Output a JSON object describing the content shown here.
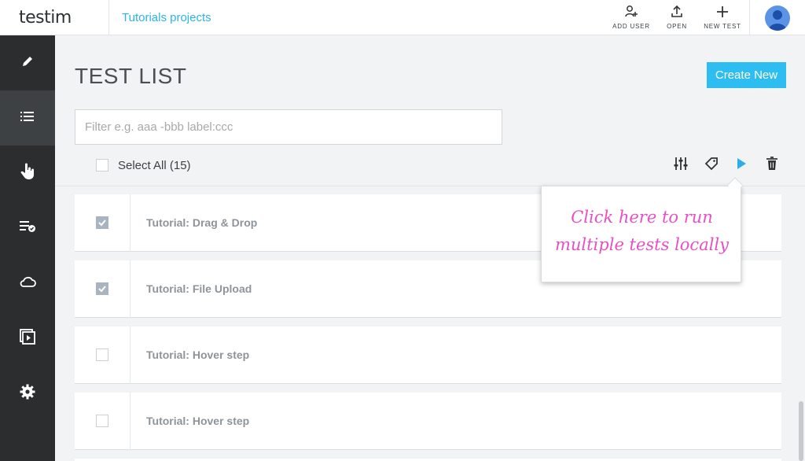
{
  "header": {
    "logo": "testim",
    "project": "Tutorials projects",
    "buttons": {
      "add_user": "ADD USER",
      "open": "OPEN",
      "new_test": "NEW TEST"
    }
  },
  "sidebar": {
    "items": [
      {
        "icon": "pencil-icon",
        "active": false
      },
      {
        "icon": "list-icon",
        "active": true
      },
      {
        "icon": "hand-pointer-icon",
        "active": false
      },
      {
        "icon": "checklist-icon",
        "active": false
      },
      {
        "icon": "cloud-icon",
        "active": false
      },
      {
        "icon": "video-icon",
        "active": false
      },
      {
        "icon": "gear-icon",
        "active": false
      }
    ]
  },
  "main": {
    "title": "TEST LIST",
    "create_button": "Create New",
    "filter_placeholder": "Filter e.g. aaa -bbb label:ccc",
    "select_all": "Select All (15)",
    "tests": [
      {
        "name": "Tutorial: Drag & Drop",
        "checked": true
      },
      {
        "name": "Tutorial: File Upload",
        "checked": true
      },
      {
        "name": "Tutorial: Hover step",
        "checked": false
      },
      {
        "name": "Tutorial: Hover step",
        "checked": false
      }
    ]
  },
  "tooltip": {
    "line1": "Click here to run",
    "line2": "multiple tests locally"
  },
  "colors": {
    "accent": "#2ebdf0",
    "sidebar": "#2b2d2f",
    "tooltip_text": "#e84fc4"
  }
}
